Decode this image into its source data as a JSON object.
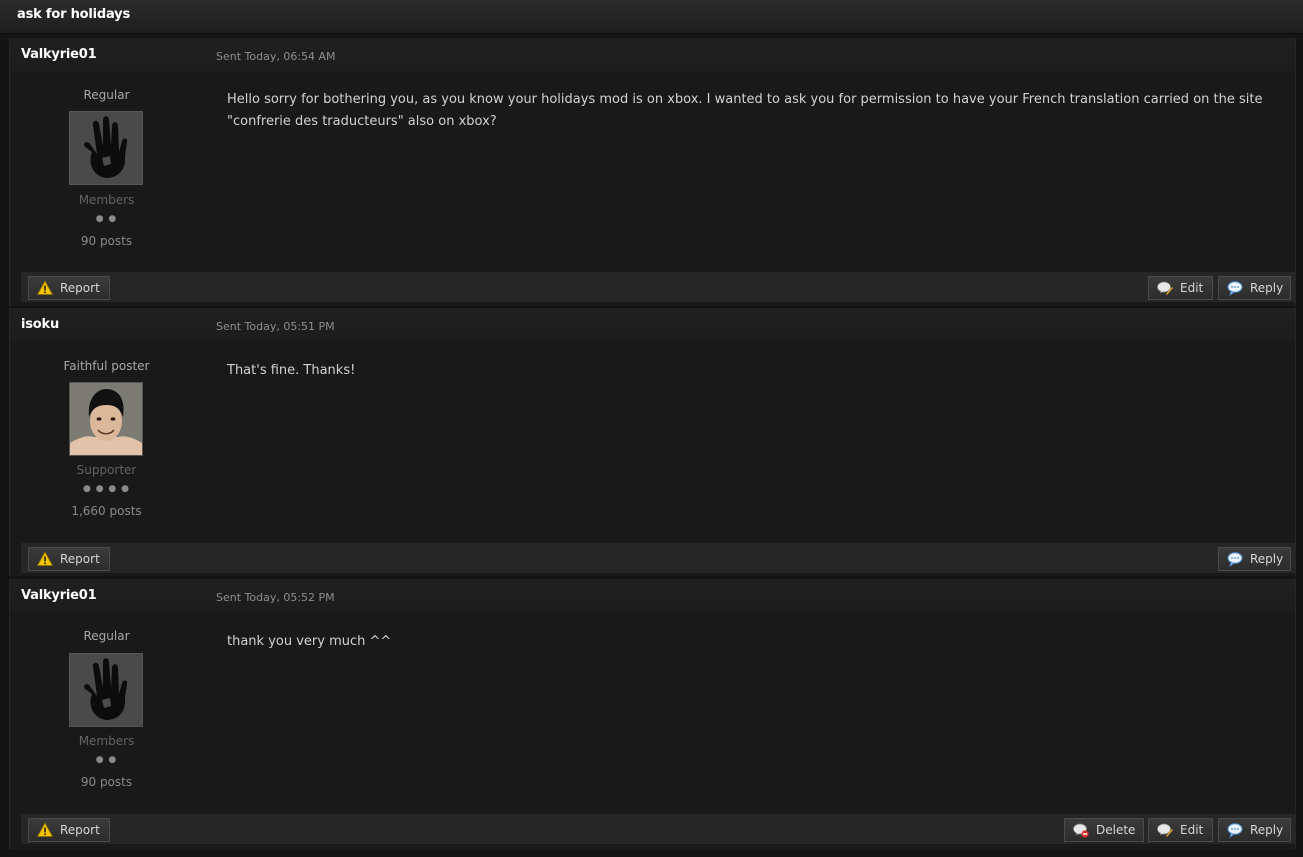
{
  "topic": {
    "title": "ask for holidays"
  },
  "posts": [
    {
      "author": "Valkyrie01",
      "sent": "Sent Today, 06:54 AM",
      "rank": "Regular",
      "avatar": "black-handprint",
      "group": "Members",
      "pips": "● ●",
      "posts": "90 posts",
      "body": "Hello sorry for bothering you, as you know your holidays mod is on xbox. I wanted to ask you for permission to have your French translation carried on the site \"confrerie des traducteurs\" also on xbox?",
      "buttons": {
        "report": "Report",
        "edit": "Edit",
        "reply": "Reply"
      }
    },
    {
      "author": "isoku",
      "sent": "Sent Today, 05:51 PM",
      "rank": "Faithful poster",
      "avatar": "face-portrait",
      "group": "Supporter",
      "pips": "● ● ● ●",
      "posts": "1,660 posts",
      "body": "That's fine. Thanks!",
      "buttons": {
        "report": "Report",
        "reply": "Reply"
      }
    },
    {
      "author": "Valkyrie01",
      "sent": "Sent Today, 05:52 PM",
      "rank": "Regular",
      "avatar": "black-handprint",
      "group": "Members",
      "pips": "● ●",
      "posts": "90 posts",
      "body": "thank you very much ^^",
      "buttons": {
        "report": "Report",
        "delete": "Delete",
        "edit": "Edit",
        "reply": "Reply"
      }
    }
  ],
  "colors": {
    "page_bg": "#141414",
    "post_bg": "#191919",
    "footer_bg": "#262626",
    "warning_icon": "#f2c500",
    "reply_icon": "#4a8fd8",
    "delete_icon": "#d83030"
  }
}
